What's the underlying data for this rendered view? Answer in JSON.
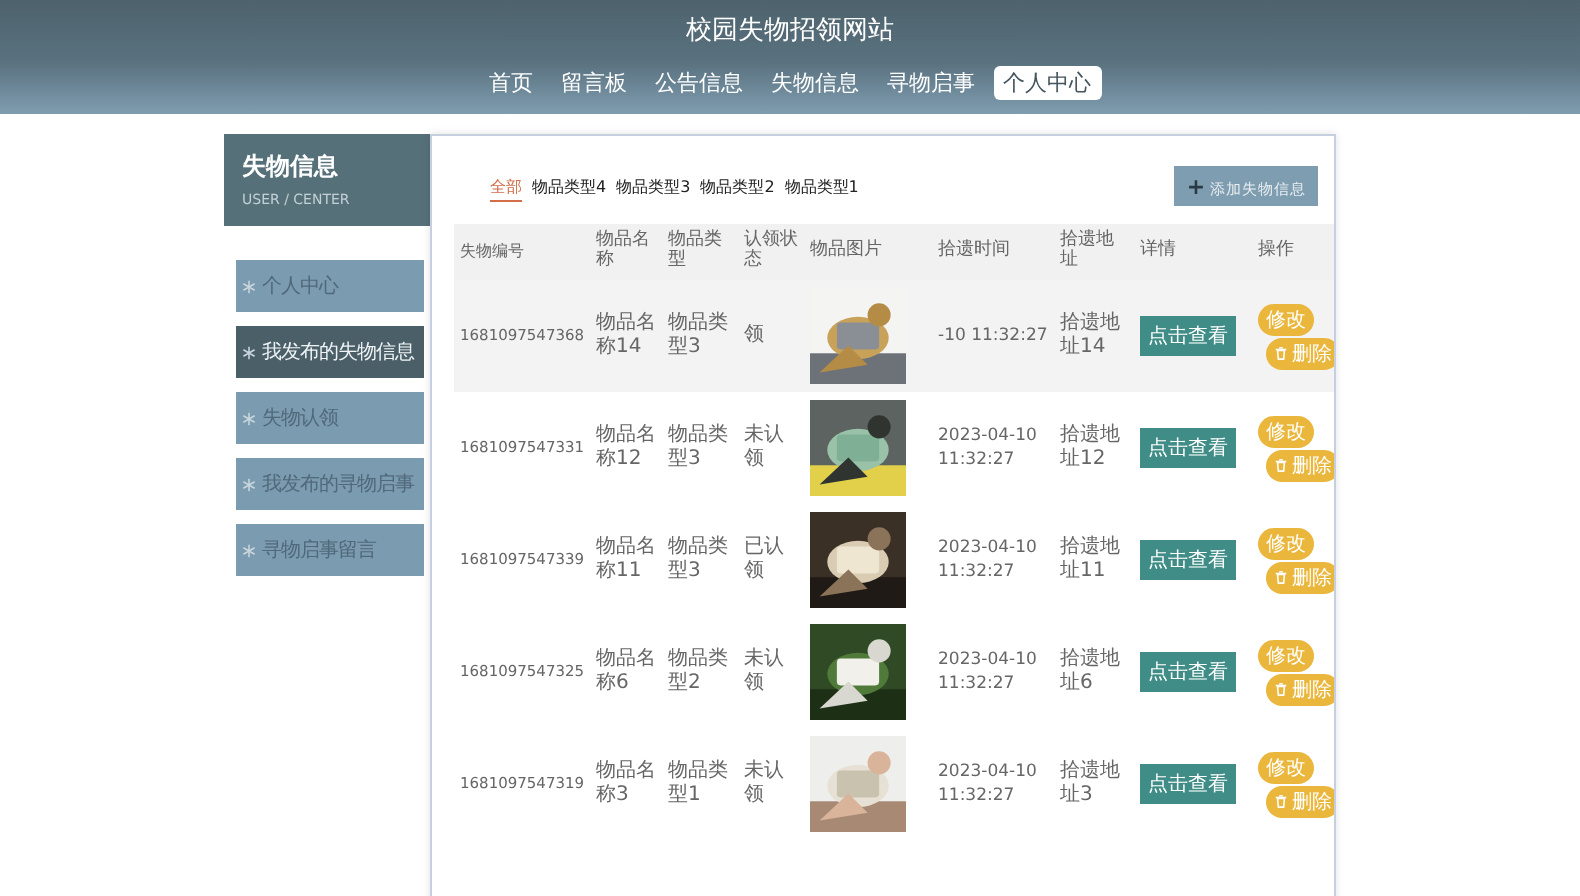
{
  "site": {
    "title": "校园失物招领网站"
  },
  "nav": [
    {
      "label": "首页",
      "selected": false
    },
    {
      "label": "留言板",
      "selected": false
    },
    {
      "label": "公告信息",
      "selected": false
    },
    {
      "label": "失物信息",
      "selected": false
    },
    {
      "label": "寻物启事",
      "selected": false
    },
    {
      "label": "个人中心",
      "selected": true
    }
  ],
  "sidebar": {
    "title": "失物信息",
    "subtitle": "USER / CENTER",
    "items": [
      {
        "label": "个人中心",
        "selected": false
      },
      {
        "label": "我发布的失物信息",
        "selected": true
      },
      {
        "label": "失物认领",
        "selected": false
      },
      {
        "label": "我发布的寻物启事",
        "selected": false
      },
      {
        "label": "寻物启事留言",
        "selected": false
      }
    ]
  },
  "filters": [
    {
      "label": "全部",
      "selected": true
    },
    {
      "label": "物品类型4",
      "selected": false
    },
    {
      "label": "物品类型3",
      "selected": false
    },
    {
      "label": "物品类型2",
      "selected": false
    },
    {
      "label": "物品类型1",
      "selected": false
    }
  ],
  "add_button": {
    "icon": "+",
    "label": "添加失物信息"
  },
  "table": {
    "columns": [
      "失物编号",
      "物品名称",
      "物品类型",
      "认领状态",
      "物品图片",
      "拾遗时间",
      "拾遗地址",
      "详情",
      "操作"
    ],
    "rows": [
      {
        "selected": true,
        "id": "1681097547368",
        "name": "物品名称14",
        "type": "物品类型3",
        "status": "领",
        "time": "-10 11:32:27",
        "address": "拾遗地址14",
        "detail": "点击查看",
        "edit": "修改",
        "delete": "删除"
      },
      {
        "selected": false,
        "id": "1681097547331",
        "name": "物品名称12",
        "type": "物品类型3",
        "status": "未认领",
        "time": "2023-04-10 11:32:27",
        "address": "拾遗地址12",
        "detail": "点击查看",
        "edit": "修改",
        "delete": "删除"
      },
      {
        "selected": false,
        "id": "1681097547339",
        "name": "物品名称11",
        "type": "物品类型3",
        "status": "已认领",
        "time": "2023-04-10 11:32:27",
        "address": "拾遗地址11",
        "detail": "点击查看",
        "edit": "修改",
        "delete": "删除"
      },
      {
        "selected": false,
        "id": "1681097547325",
        "name": "物品名称6",
        "type": "物品类型2",
        "status": "未认领",
        "time": "2023-04-10 11:32:27",
        "address": "拾遗地址6",
        "detail": "点击查看",
        "edit": "修改",
        "delete": "删除"
      },
      {
        "selected": false,
        "id": "1681097547319",
        "name": "物品名称3",
        "type": "物品类型1",
        "status": "未认领",
        "time": "2023-04-10 11:32:27",
        "address": "拾遗地址3",
        "detail": "点击查看",
        "edit": "修改",
        "delete": "删除"
      }
    ]
  }
}
